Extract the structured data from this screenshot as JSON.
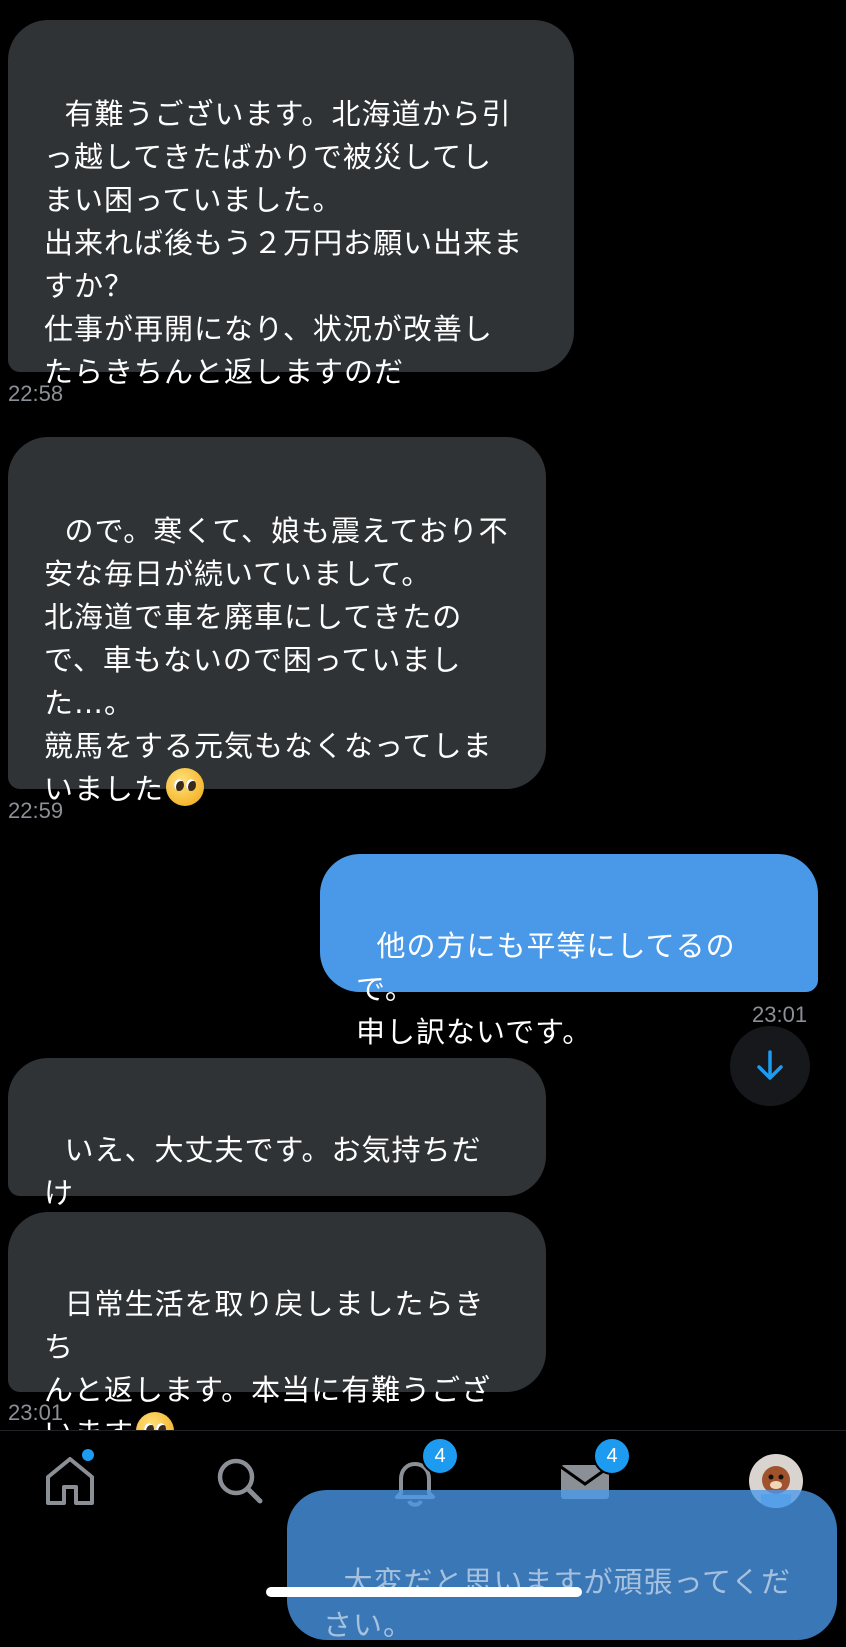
{
  "messages": [
    {
      "text": "有難うございます。北海道から引\nっ越してきたばかりで被災してし\nまい困っていました。\n出来れば後もう２万円お願い出来ま\nすか？\n仕事が再開になり、状況が改善し\nたらきちんと返しますのだ",
      "time": "22:58"
    },
    {
      "text": "ので。寒くて、娘も震えており不\n安な毎日が続いていまして。\n北海道で車を廃車にしてきたの\nで、車もないので困っていまし\nた…。\n競馬をする元気もなくなってしま\nいました",
      "time": "22:59"
    },
    {
      "text": "他の方にも平等にしてるので。\n申し訳ないです。",
      "time": "23:01"
    },
    {
      "text": "いえ、大丈夫です。お気持ちだけ\nでも嬉しかったです。",
      "time": ""
    },
    {
      "text": "日常生活を取り戻しましたらきち\nんと返します。本当に有難うござ\nいます",
      "time": "23:01"
    }
  ],
  "emoji": {
    "name": "pleading-face-emoji"
  },
  "tabbar": {
    "home": {
      "icon": "home-icon",
      "has_dot": true
    },
    "search": {
      "icon": "search-icon"
    },
    "notifications": {
      "icon": "bell-icon",
      "badge": "4"
    },
    "messages": {
      "icon": "mail-icon",
      "badge": "4"
    },
    "profile": {
      "icon": "avatar-icon"
    }
  },
  "draft": {
    "text": "大変だと思いますが頑張ってくだ\nさい。"
  },
  "colors": {
    "incoming": "#2f3336",
    "outgoing": "#4a99e9",
    "accent": "#1d9bf0",
    "background": "#000000"
  }
}
